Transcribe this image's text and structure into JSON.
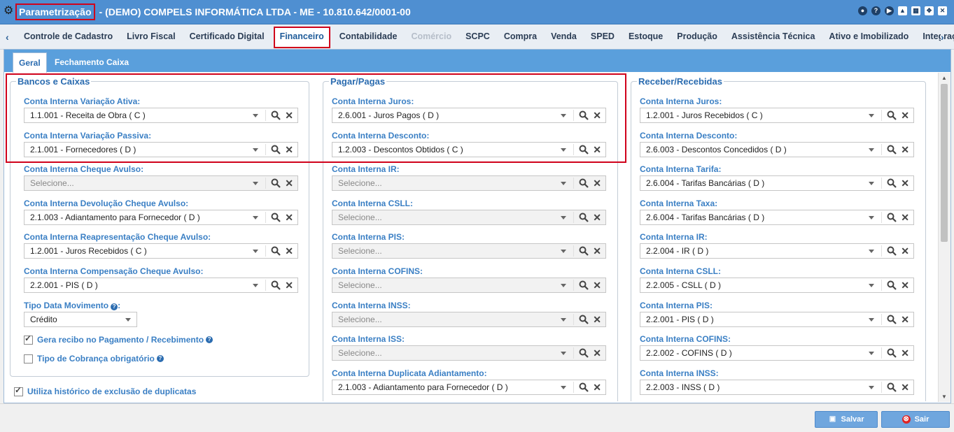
{
  "window": {
    "title_prefix": "Parametrização",
    "title_rest": "- (DEMO) COMPELS INFORMÁTICA LTDA - ME - 10.810.642/0001-00"
  },
  "tabs": [
    {
      "label": "Controle de Cadastro"
    },
    {
      "label": "Livro Fiscal"
    },
    {
      "label": "Certificado Digital"
    },
    {
      "label": "Financeiro"
    },
    {
      "label": "Contabilidade"
    },
    {
      "label": "Comércio"
    },
    {
      "label": "SCPC"
    },
    {
      "label": "Compra"
    },
    {
      "label": "Venda"
    },
    {
      "label": "SPED"
    },
    {
      "label": "Estoque"
    },
    {
      "label": "Produção"
    },
    {
      "label": "Assistência Técnica"
    },
    {
      "label": "Ativo e Imobilizado"
    },
    {
      "label": "Integraçõ"
    }
  ],
  "subtabs": {
    "geral": "Geral",
    "fechamento": "Fechamento Caixa"
  },
  "bancos": {
    "legend": "Bancos e Caixas",
    "fields": [
      {
        "label": "Conta Interna Variação Ativa:",
        "value": "1.1.001 - Receita de Obra ( C )"
      },
      {
        "label": "Conta Interna Variação Passiva:",
        "value": "2.1.001 - Fornecedores ( D )"
      },
      {
        "label": "Conta Interna Cheque Avulso:",
        "value": "Selecione..."
      },
      {
        "label": "Conta Interna Devolução Cheque Avulso:",
        "value": "2.1.003 - Adiantamento para Fornecedor ( D )"
      },
      {
        "label": "Conta Interna Reapresentação Cheque Avulso:",
        "value": "1.2.001 - Juros Recebidos ( C )"
      },
      {
        "label": "Conta Interna Compensação Cheque Avulso:",
        "value": "2.2.001 - PIS ( D )"
      }
    ],
    "tipo_label": "Tipo Data Movimento",
    "tipo_value": "Crédito",
    "gera_recibo": "Gera recibo no Pagamento / Recebimento",
    "tipo_cobranca": "Tipo de Cobrança obrigatório"
  },
  "pagar": {
    "legend": "Pagar/Pagas",
    "fields": [
      {
        "label": "Conta Interna Juros:",
        "value": "2.6.001 - Juros Pagos ( D )"
      },
      {
        "label": "Conta Interna Desconto:",
        "value": "1.2.003 - Descontos Obtidos ( C )"
      },
      {
        "label": "Conta Interna IR:",
        "value": "Selecione..."
      },
      {
        "label": "Conta Interna CSLL:",
        "value": "Selecione..."
      },
      {
        "label": "Conta Interna PIS:",
        "value": "Selecione..."
      },
      {
        "label": "Conta Interna COFINS:",
        "value": "Selecione..."
      },
      {
        "label": "Conta Interna INSS:",
        "value": "Selecione..."
      },
      {
        "label": "Conta Interna ISS:",
        "value": "Selecione..."
      },
      {
        "label": "Conta Interna Duplicata Adiantamento:",
        "value": "2.1.003 - Adiantamento para Fornecedor ( D )"
      }
    ]
  },
  "receber": {
    "legend": "Receber/Recebidas",
    "fields": [
      {
        "label": "Conta Interna Juros:",
        "value": "1.2.001 - Juros Recebidos ( C )"
      },
      {
        "label": "Conta Interna Desconto:",
        "value": "2.6.003 - Descontos Concedidos ( D )"
      },
      {
        "label": "Conta Interna Tarifa:",
        "value": "2.6.004 - Tarifas Bancárias ( D )"
      },
      {
        "label": "Conta Interna Taxa:",
        "value": "2.6.004 - Tarifas Bancárias ( D )"
      },
      {
        "label": "Conta Interna IR:",
        "value": "2.2.004 - IR ( D )"
      },
      {
        "label": "Conta Interna CSLL:",
        "value": "2.2.005 - CSLL ( D )"
      },
      {
        "label": "Conta Interna PIS:",
        "value": "2.2.001 - PIS ( D )"
      },
      {
        "label": "Conta Interna COFINS:",
        "value": "2.2.002 - COFINS ( D )"
      },
      {
        "label": "Conta Interna INSS:",
        "value": "2.2.003 - INSS ( D )"
      }
    ]
  },
  "historico": "Utiliza histórico de exclusão de duplicatas",
  "buttons": {
    "save": "Salvar",
    "exit": "Sair"
  }
}
